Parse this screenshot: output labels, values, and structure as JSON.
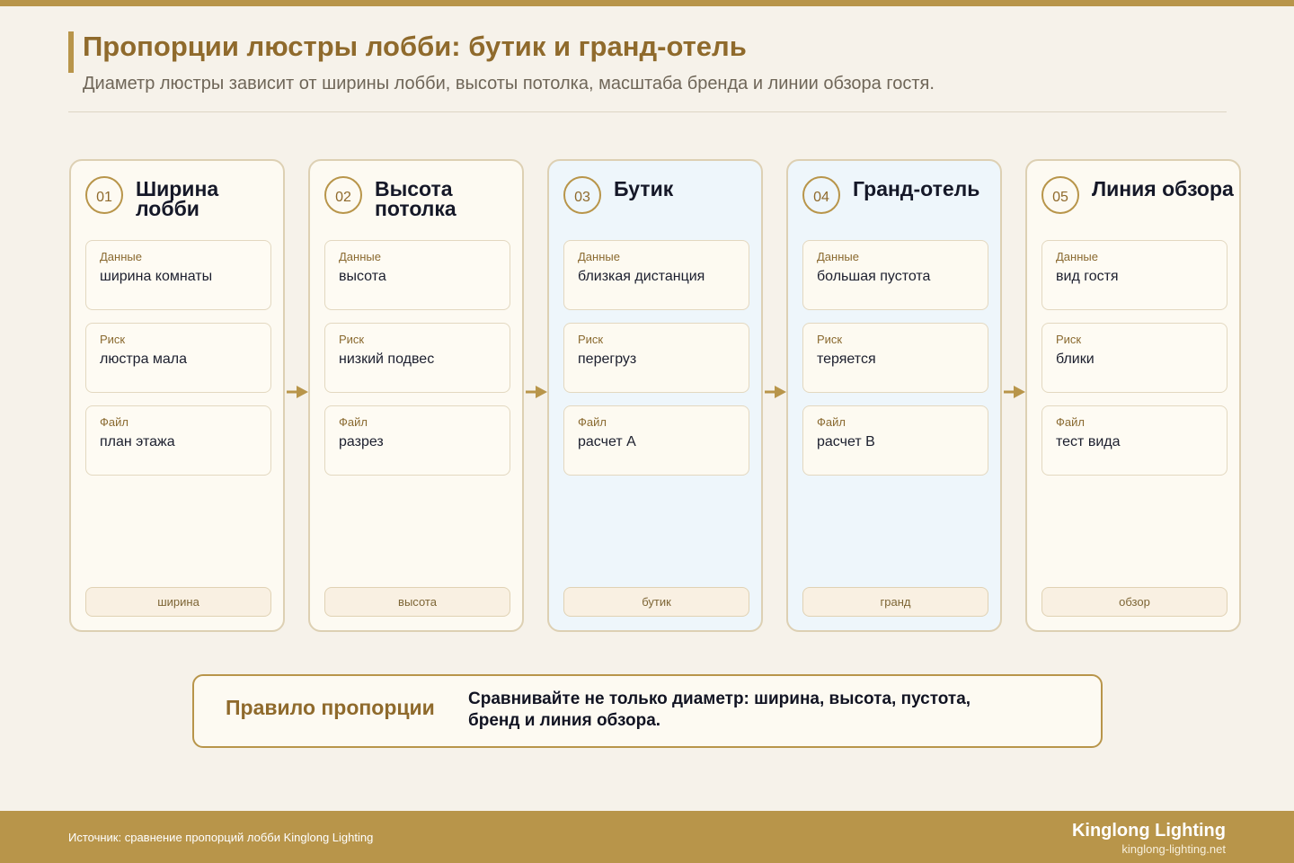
{
  "header": {
    "title": "Пропорции люстры лобби: бутик и гранд-отель",
    "subtitle": "Диаметр люстры зависит от ширины лобби, высоты потолка, масштаба бренда и линии обзора гостя."
  },
  "cards": [
    {
      "number": "01",
      "title": "Ширина лобби",
      "highlighted": false,
      "fields": [
        {
          "label": "Данные",
          "value": "ширина комнаты"
        },
        {
          "label": "Риск",
          "value": "люстра мала"
        },
        {
          "label": "Файл",
          "value": "план этажа"
        }
      ],
      "tag": "ширина"
    },
    {
      "number": "02",
      "title": "Высота потолка",
      "highlighted": false,
      "fields": [
        {
          "label": "Данные",
          "value": "высота"
        },
        {
          "label": "Риск",
          "value": "низкий подвес"
        },
        {
          "label": "Файл",
          "value": "разрез"
        }
      ],
      "tag": "высота"
    },
    {
      "number": "03",
      "title": "Бутик",
      "highlighted": true,
      "fields": [
        {
          "label": "Данные",
          "value": "близкая дистанция"
        },
        {
          "label": "Риск",
          "value": "перегруз"
        },
        {
          "label": "Файл",
          "value": "расчет A"
        }
      ],
      "tag": "бутик"
    },
    {
      "number": "04",
      "title": "Гранд-отель",
      "highlighted": true,
      "fields": [
        {
          "label": "Данные",
          "value": "большая пустота"
        },
        {
          "label": "Риск",
          "value": "теряется"
        },
        {
          "label": "Файл",
          "value": "расчет B"
        }
      ],
      "tag": "гранд"
    },
    {
      "number": "05",
      "title": "Линия обзора",
      "highlighted": false,
      "fields": [
        {
          "label": "Данные",
          "value": "вид гостя"
        },
        {
          "label": "Риск",
          "value": "блики"
        },
        {
          "label": "Файл",
          "value": "тест вида"
        }
      ],
      "tag": "обзор"
    }
  ],
  "rule": {
    "title": "Правило пропорции",
    "text": "Сравнивайте не только диаметр: ширина, высота, пустота, бренд и линия обзора."
  },
  "footer": {
    "source": "Источник: сравнение пропорций лобби Kinglong Lighting",
    "brand": "Kinglong Lighting",
    "url": "kinglong-lighting.net"
  },
  "colors": {
    "accent": "#b8954a",
    "title": "#8f6a2c",
    "background": "#f6f2ea",
    "card": "#fdfaf2",
    "card_highlight": "#eef6fb"
  },
  "icons": {
    "connector": "arrow-right-icon"
  }
}
